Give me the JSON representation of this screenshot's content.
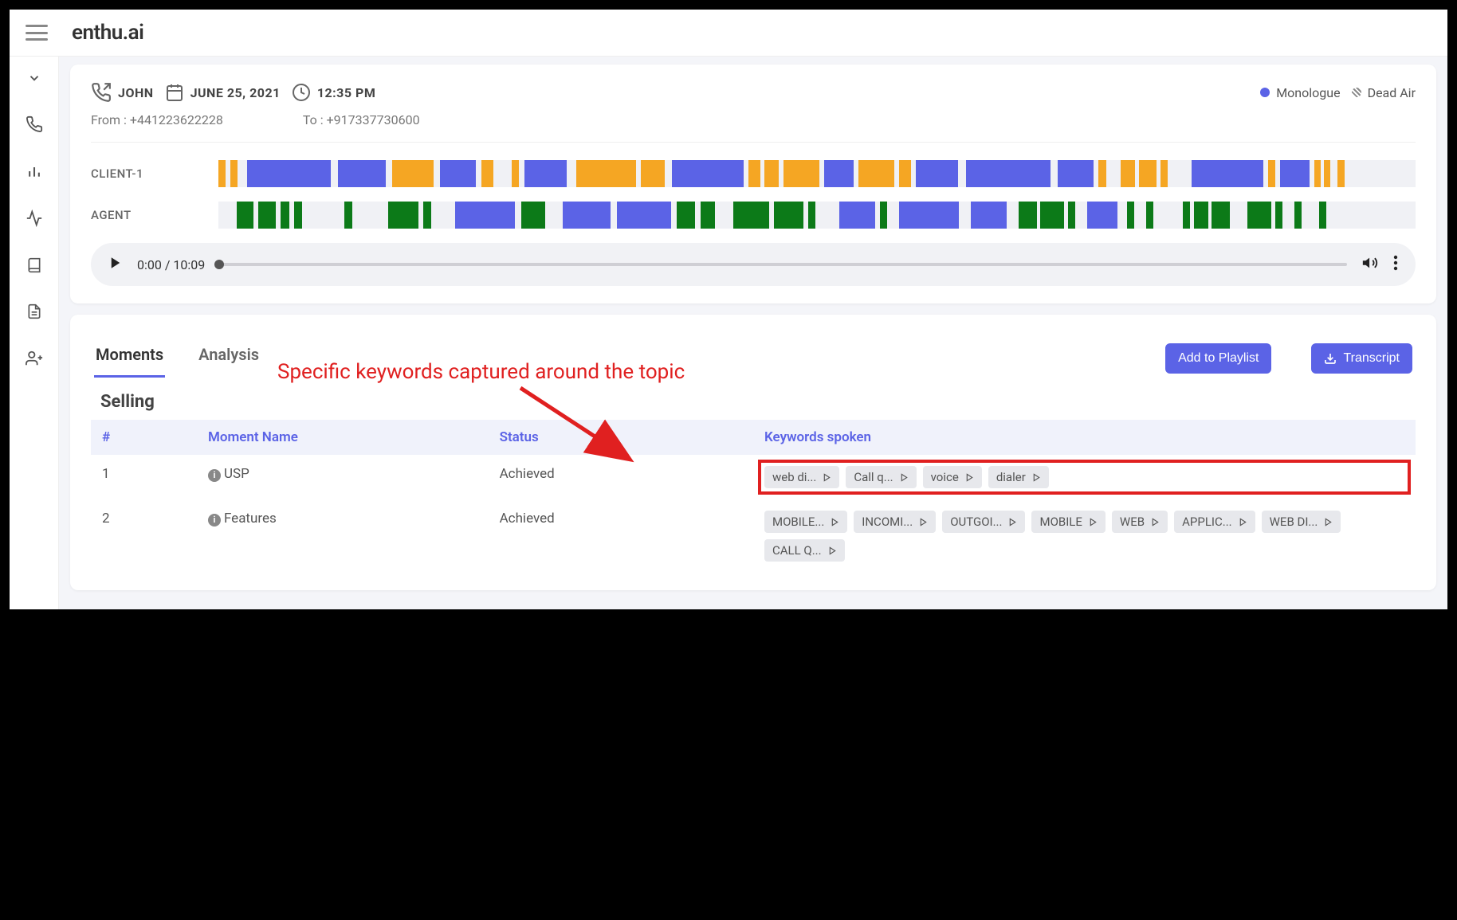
{
  "brand": "enthu.ai",
  "call": {
    "agent": "JOHN",
    "date": "JUNE 25, 2021",
    "time": "12:35 PM",
    "from_label": "From :",
    "from": "+441223622228",
    "to_label": "To :",
    "to": "+917337730600"
  },
  "legend": {
    "monologue": "Monologue",
    "deadair": "Dead Air"
  },
  "tracks": {
    "client": "CLIENT-1",
    "agent": "AGENT"
  },
  "player": {
    "time": "0:00 / 10:09"
  },
  "tabs": {
    "moments": "Moments",
    "analysis": "Analysis"
  },
  "buttons": {
    "addPlaylist": "Add to Playlist",
    "transcript": "Transcript"
  },
  "section": {
    "title": "Selling"
  },
  "table": {
    "headers": {
      "num": "#",
      "name": "Moment Name",
      "status": "Status",
      "keywords": "Keywords spoken"
    },
    "rows": [
      {
        "num": "1",
        "name": "USP",
        "status": "Achieved",
        "chips": [
          "web di...",
          "Call q...",
          "voice",
          "dialer"
        ]
      },
      {
        "num": "2",
        "name": "Features",
        "status": "Achieved",
        "chips": [
          "MOBILE...",
          "INCOMI...",
          "OUTGOI...",
          "MOBILE",
          "WEB",
          "APPLIC...",
          "WEB DI...",
          "CALL Q..."
        ]
      }
    ]
  },
  "annotation": "Specific keywords captured around the topic"
}
